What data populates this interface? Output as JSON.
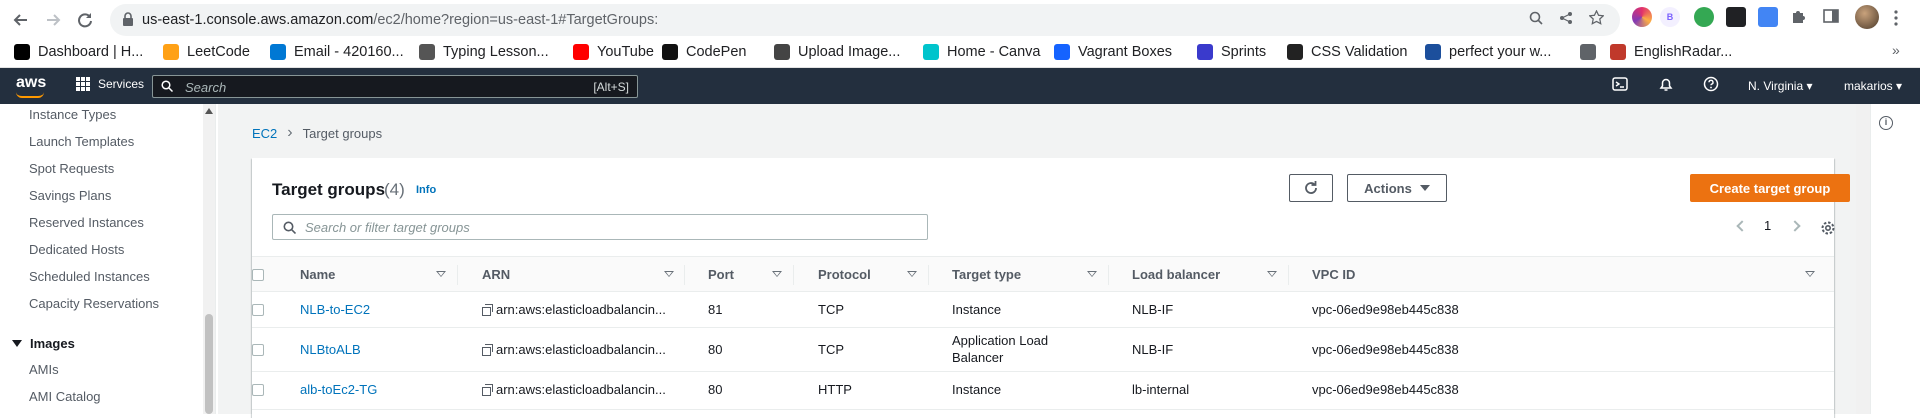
{
  "browser": {
    "url_host": "us-east-1.console.aws.amazon.com",
    "url_path": "/ec2/home?region=us-east-1#TargetGroups:",
    "bookmarks": [
      {
        "label": "Dashboard | H...",
        "icon": "dashboard-favicon",
        "color": "#000000"
      },
      {
        "label": "LeetCode",
        "icon": "leetcode-favicon",
        "color": "#ffa116"
      },
      {
        "label": "Email - 420160...",
        "icon": "outlook-favicon",
        "color": "#0078d4"
      },
      {
        "label": "Typing Lesson...",
        "icon": "typing-favicon",
        "color": "#555555"
      },
      {
        "label": "YouTube",
        "icon": "youtube-favicon",
        "color": "#ff0000"
      },
      {
        "label": "CodePen",
        "icon": "codepen-favicon",
        "color": "#111111"
      },
      {
        "label": "Upload Image...",
        "icon": "upload-favicon",
        "color": "#444444"
      },
      {
        "label": "Home - Canva",
        "icon": "canva-favicon",
        "color": "#00c4cc"
      },
      {
        "label": "Vagrant Boxes",
        "icon": "vagrant-favicon",
        "color": "#1563ff"
      },
      {
        "label": "Sprints",
        "icon": "sprints-favicon",
        "color": "#3a3acc"
      },
      {
        "label": "CSS Validation",
        "icon": "css-favicon",
        "color": "#222222"
      },
      {
        "label": "perfect your w...",
        "icon": "tr-favicon",
        "color": "#1c4f9c"
      },
      {
        "label": "",
        "icon": "globe-favicon",
        "color": "#5f6368"
      },
      {
        "label": "EnglishRadar...",
        "icon": "englishradar-favicon",
        "color": "#c0392b"
      }
    ]
  },
  "aws": {
    "logo": "aws",
    "services_label": "Services",
    "search_placeholder": "Search",
    "search_shortcut": "[Alt+S]",
    "region": "N. Virginia",
    "user": "makarios"
  },
  "sidebar": {
    "items": [
      "Instance Types",
      "Launch Templates",
      "Spot Requests",
      "Savings Plans",
      "Reserved Instances",
      "Dedicated Hosts",
      "Scheduled Instances",
      "Capacity Reservations"
    ],
    "section": "Images",
    "section_items": [
      "AMIs",
      "AMI Catalog"
    ]
  },
  "breadcrumb": {
    "parent": "EC2",
    "current": "Target groups"
  },
  "panel": {
    "title": "Target groups",
    "count": "(4)",
    "info": "Info",
    "actions_label": "Actions",
    "create_label": "Create target group",
    "filter_placeholder": "Search or filter target groups",
    "page": "1"
  },
  "table": {
    "columns": [
      "Name",
      "ARN",
      "Port",
      "Protocol",
      "Target type",
      "Load balancer",
      "VPC ID"
    ],
    "rows": [
      {
        "name": "NLB-to-EC2",
        "arn": "arn:aws:elasticloadbalancin...",
        "port": "81",
        "protocol": "TCP",
        "target_type": "Instance",
        "target_type_2": "",
        "lb": "NLB-IF",
        "vpc": "vpc-06ed9e98eb445c838"
      },
      {
        "name": "NLBtoALB",
        "arn": "arn:aws:elasticloadbalancin...",
        "port": "80",
        "protocol": "TCP",
        "target_type": "Application Load",
        "target_type_2": "Balancer",
        "lb": "NLB-IF",
        "vpc": "vpc-06ed9e98eb445c838"
      },
      {
        "name": "alb-toEc2-TG",
        "arn": "arn:aws:elasticloadbalancin...",
        "port": "80",
        "protocol": "HTTP",
        "target_type": "Instance",
        "target_type_2": "",
        "lb": "lb-internal",
        "vpc": "vpc-06ed9e98eb445c838"
      }
    ]
  },
  "colors": {
    "accent_orange": "#ec7211",
    "link_blue": "#0073bb",
    "aws_nav": "#232f3e"
  }
}
